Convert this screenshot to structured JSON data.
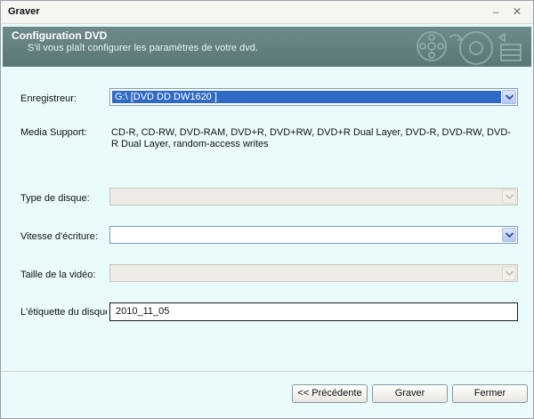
{
  "window": {
    "title": "Graver",
    "minimize_glyph": "–",
    "close_glyph": "✕"
  },
  "header": {
    "title": "Configuration DVD",
    "subtitle": "S'il vous plaît configurer les paramètres de votre dvd."
  },
  "form": {
    "recorder_label": "Enregistreur:",
    "recorder_value": "G:\\ [DVD DD DW1620    ]",
    "media_label": "Media Support:",
    "media_value": "CD-R, CD-RW, DVD-RAM, DVD+R, DVD+RW, DVD+R Dual Layer, DVD-R, DVD-RW, DVD-R Dual Layer, random-access writes",
    "disc_type_label": "Type de disque:",
    "disc_type_value": "",
    "write_speed_label": "Vitesse d'écriture:",
    "write_speed_value": "",
    "video_size_label": "Taille de la vidéo:",
    "video_size_value": "",
    "disc_label_label": "L'étiquette du disque:",
    "disc_label_value": "2010_11_05"
  },
  "buttons": {
    "previous": "<< Précédente",
    "burn": "Graver",
    "close": "Fermer"
  },
  "colors": {
    "header_bg": "#647f80",
    "dialog_bg": "#e9fbfb",
    "selection": "#316ac5"
  }
}
